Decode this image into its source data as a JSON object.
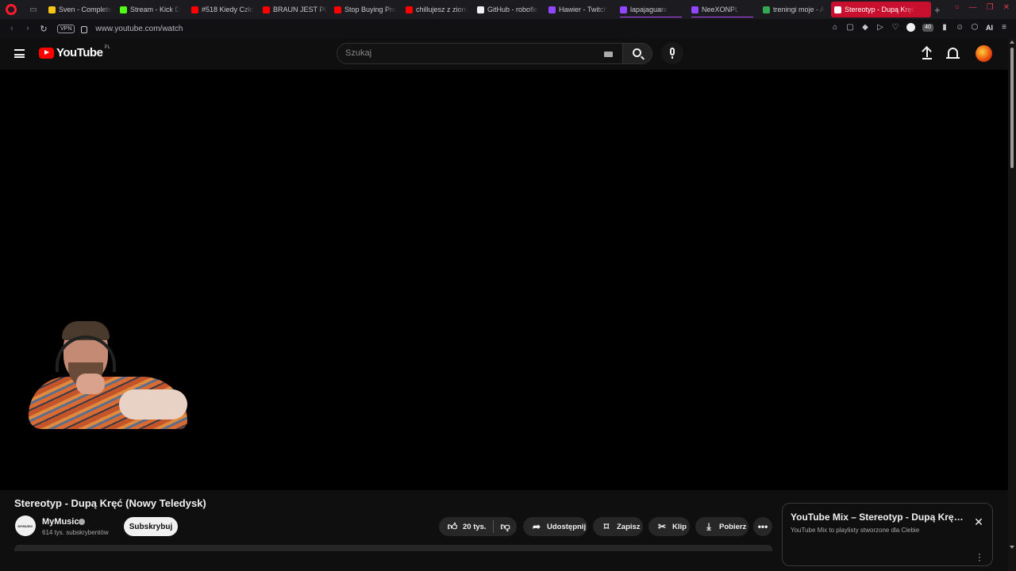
{
  "browser": {
    "tabs": [
      {
        "label": "Sven - Complete",
        "fav_color": "#f5c518",
        "icon": "crown-icon"
      },
      {
        "label": "Stream - Kick D",
        "fav_color": "#53fc18",
        "icon": "kick-icon"
      },
      {
        "label": "#518 Kiedy Czło",
        "fav_color": "#ff0000",
        "icon": "youtube-icon"
      },
      {
        "label": "BRAUN JEST PO",
        "fav_color": "#ff0000",
        "icon": "youtube-icon"
      },
      {
        "label": "Stop Buying Pro",
        "fav_color": "#ff0000",
        "icon": "youtube-icon"
      },
      {
        "label": "chillujesz z ziom",
        "fav_color": "#ff0000",
        "icon": "youtube-icon"
      },
      {
        "label": "GitHub - robofle",
        "fav_color": "#f1f1f1",
        "icon": "github-icon"
      },
      {
        "label": "Hawier - Twitch",
        "fav_color": "#9146ff",
        "icon": "twitch-icon"
      },
      {
        "label": "lapajaguara",
        "fav_color": "#9146ff",
        "icon": "twitch-icon"
      },
      {
        "label": "NeeXONPL",
        "fav_color": "#9146ff",
        "icon": "twitch-icon"
      },
      {
        "label": "treningi moje - A",
        "fav_color": "#34a853",
        "icon": "sheets-icon"
      },
      {
        "label": "Stereotyp - Dupą Kręć",
        "fav_color": "#ffffff",
        "icon": "speaker-icon",
        "active": true
      }
    ],
    "url": "www.youtube.com/watch",
    "vpn_label": "VPN",
    "ai_label": "AI",
    "ext_badge": "40"
  },
  "youtube": {
    "logo_text": "YouTube",
    "region": "PL",
    "search_placeholder": "Szukaj",
    "video_title": "Stereotyp - Dupą Kręć (Nowy Teledysk)",
    "channel": {
      "name": "MyMusic",
      "avatar_text": "MYMUSIC",
      "subscribers": "614 tys. subskrybentów"
    },
    "subscribe_label": "Subskrybuj",
    "actions": {
      "likes": "20 tys.",
      "share": "Udostępnij",
      "save": "Zapisz",
      "clip": "Klip",
      "download": "Pobierz"
    },
    "mix": {
      "title": "YouTube Mix – Stereotyp - Dupą Kręć (Nowy Teledysk)",
      "subtitle": "YouTube Mix to playlisty stworzone dla Ciebie"
    }
  },
  "colors": {
    "brand_red": "#ff0000",
    "tab_active": "#c8102e",
    "background": "#0f0f0f"
  }
}
